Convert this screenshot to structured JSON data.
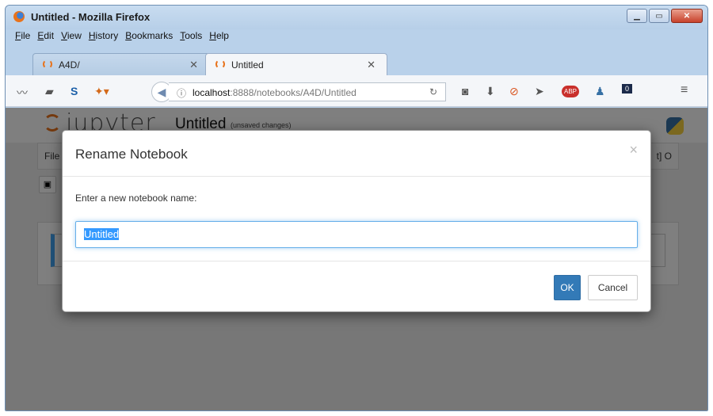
{
  "window": {
    "title": "Untitled - Mozilla Firefox"
  },
  "menu": [
    "File",
    "Edit",
    "View",
    "History",
    "Bookmarks",
    "Tools",
    "Help"
  ],
  "tabs": [
    {
      "label": "A4D/",
      "active": false
    },
    {
      "label": "Untitled",
      "active": true
    }
  ],
  "urlbar": {
    "host": "localhost",
    "path": ":8888/notebooks/A4D/Untitled"
  },
  "toolbar_badge": "0",
  "adblock_label": "ABP",
  "jupyter": {
    "wordmark": "jupyter",
    "notebook_title": "Untitled",
    "unsaved": "(unsaved changes)",
    "menu_file_fragment": "File",
    "kernel_fragment": "t] O"
  },
  "dialog": {
    "title": "Rename Notebook",
    "close": "×",
    "prompt": "Enter a new notebook name:",
    "input_value": "Untitled",
    "ok_label": "OK",
    "cancel_label": "Cancel"
  },
  "colors": {
    "accent": "#337ab7",
    "focus": "#66afe9",
    "selection": "#3399ff"
  }
}
